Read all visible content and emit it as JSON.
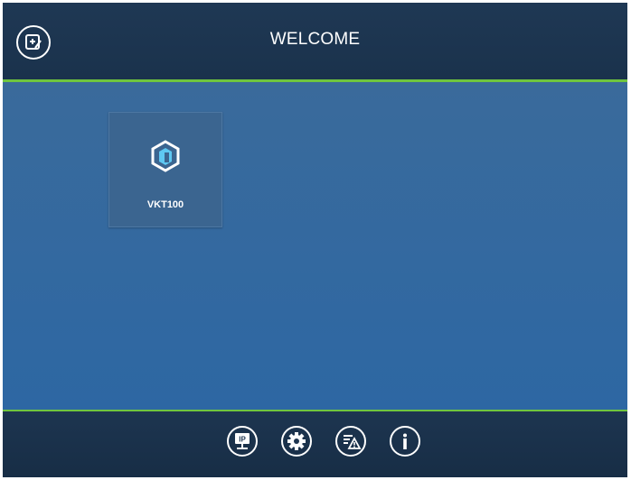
{
  "header": {
    "title": "WELCOME",
    "edit_icon": "edit-note-icon"
  },
  "devices": [
    {
      "label": "VKT100",
      "icon": "hexagon-device-icon"
    }
  ],
  "footer": {
    "buttons": [
      {
        "name": "ip-settings-button",
        "icon": "ip-monitor-icon",
        "icon_text": "IP"
      },
      {
        "name": "settings-button",
        "icon": "gear-icon"
      },
      {
        "name": "alarm-log-button",
        "icon": "warning-list-icon"
      },
      {
        "name": "info-button",
        "icon": "info-icon"
      }
    ]
  },
  "colors": {
    "accent_line": "#6fc53f",
    "header_bg": "#1f3854",
    "main_bg": "#3369a0",
    "tile_bg": "#3b6590",
    "icon_cyan": "#5ec8f2"
  }
}
